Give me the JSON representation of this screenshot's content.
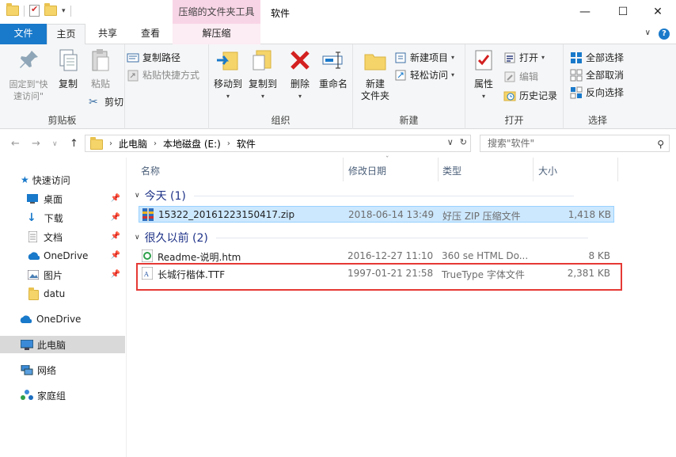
{
  "window": {
    "title": "软件",
    "context_tab_group": "压缩的文件夹工具",
    "controls": {
      "minimize": "—",
      "maximize": "☐",
      "close": "✕"
    }
  },
  "tabs": {
    "file": "文件",
    "home": "主页",
    "share": "共享",
    "view": "查看",
    "extract": "解压缩"
  },
  "ribbon": {
    "clipboard": {
      "label": "剪贴板",
      "pin": "固定到\"快\n速访问\"",
      "copy": "复制",
      "paste": "粘贴",
      "copy_path": "复制路径",
      "paste_shortcut": "粘贴快捷方式",
      "cut": "剪切"
    },
    "organize": {
      "label": "组织",
      "move_to": "移动到",
      "copy_to": "复制到",
      "delete": "删除",
      "rename": "重命名"
    },
    "new": {
      "label": "新建",
      "new_folder": "新建\n文件夹",
      "new_item": "新建项目",
      "easy_access": "轻松访问"
    },
    "open": {
      "label": "打开",
      "properties": "属性",
      "open": "打开",
      "edit": "编辑",
      "history": "历史记录"
    },
    "select": {
      "label": "选择",
      "select_all": "全部选择",
      "select_none": "全部取消",
      "invert": "反向选择"
    }
  },
  "address": {
    "crumbs": [
      "此电脑",
      "本地磁盘 (E:)",
      "软件"
    ],
    "search_placeholder": "搜索\"软件\""
  },
  "nav": {
    "quick_access": "快速访问",
    "desktop": "桌面",
    "downloads": "下载",
    "documents": "文档",
    "onedrive_pinned": "OneDrive",
    "pictures": "图片",
    "datu": "datu",
    "onedrive": "OneDrive",
    "this_pc": "此电脑",
    "network": "网络",
    "homegroup": "家庭组"
  },
  "columns": {
    "name": "名称",
    "modified": "修改日期",
    "type": "类型",
    "size": "大小"
  },
  "groups": [
    {
      "title": "今天 (1)",
      "files": [
        {
          "name": "15322_20161223150417.zip",
          "modified": "2018-06-14 13:49",
          "type": "好压 ZIP 压缩文件",
          "size": "1,418 KB"
        }
      ]
    },
    {
      "title": "很久以前 (2)",
      "files": [
        {
          "name": "Readme-说明.htm",
          "modified": "2016-12-27 11:10",
          "type": "360 se HTML Do...",
          "size": "8 KB"
        },
        {
          "name": "长城行楷体.TTF",
          "modified": "1997-01-21 21:58",
          "type": "TrueType 字体文件",
          "size": "2,381 KB"
        }
      ]
    }
  ],
  "colors": {
    "accent": "#1979ca",
    "context_tab": "#f8d5e6",
    "selection": "#cce8ff",
    "highlight_box": "#e53935"
  }
}
